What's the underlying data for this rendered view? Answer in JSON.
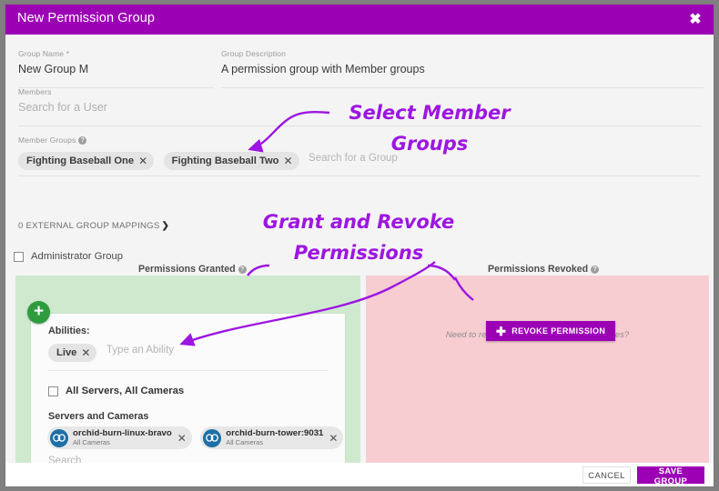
{
  "dialog": {
    "title": "New Permission Group",
    "close_icon": "close-icon"
  },
  "form": {
    "group_name": {
      "label": "Group Name *",
      "value": "New Group M"
    },
    "group_description": {
      "label": "Group Description",
      "value": "A permission group with Member groups"
    },
    "members": {
      "label": "Members",
      "placeholder": "Search for a User"
    },
    "member_groups": {
      "label": "Member Groups",
      "help_icon": "question-mark-icon",
      "placeholder": "Search for a Group",
      "chips": [
        "Fighting Baseball One",
        "Fighting Baseball Two"
      ],
      "chip_remove_icon": "✕"
    },
    "external_mappings": {
      "label": "0 EXTERNAL GROUP MAPPINGS",
      "caret": "❯"
    },
    "administrator_group": {
      "label": "Administrator Group",
      "checked": false
    }
  },
  "permissions": {
    "granted": {
      "heading": "Permissions Granted",
      "help_icon": "question-mark-icon",
      "add_icon": "plus-circle-icon",
      "abilities_label": "Abilities:",
      "ability_chips": [
        "Live"
      ],
      "ability_placeholder": "Type an Ability",
      "all_servers_label": "All Servers, All Cameras",
      "all_servers_checked": false,
      "servers_label": "Servers and Cameras",
      "servers": [
        {
          "name": "orchid-burn-linux-bravo",
          "sub": "All Cameras",
          "icon": "camera-server-icon"
        },
        {
          "name": "orchid-burn-tower:9031",
          "sub": "All Cameras",
          "icon": "camera-server-icon"
        }
      ],
      "search_placeholder": "Search",
      "bg_color": "#cfe9cf"
    },
    "revoked": {
      "heading": "Permissions Revoked",
      "help_icon": "question-mark-icon",
      "prompt": "Need to revoke access to cameras or features?",
      "button_label": "REVOKE PERMISSION",
      "button_icon": "plus-icon",
      "bg_color": "#f7cdd2"
    }
  },
  "footer": {
    "cancel_label": "CANCEL",
    "save_label": "SAVE GROUP"
  },
  "annotations": [
    {
      "text": "Select Member\nGroups"
    },
    {
      "text": "Grant and Revoke\nPermissions"
    }
  ],
  "colors": {
    "brand_purple": "#9c00b5",
    "annotation_purple": "#9d16e0",
    "granted_green": "#cfe9cf",
    "revoked_pink": "#f7cdd2",
    "add_green": "#2e9b3f",
    "server_icon_blue": "#1d6fa5"
  }
}
